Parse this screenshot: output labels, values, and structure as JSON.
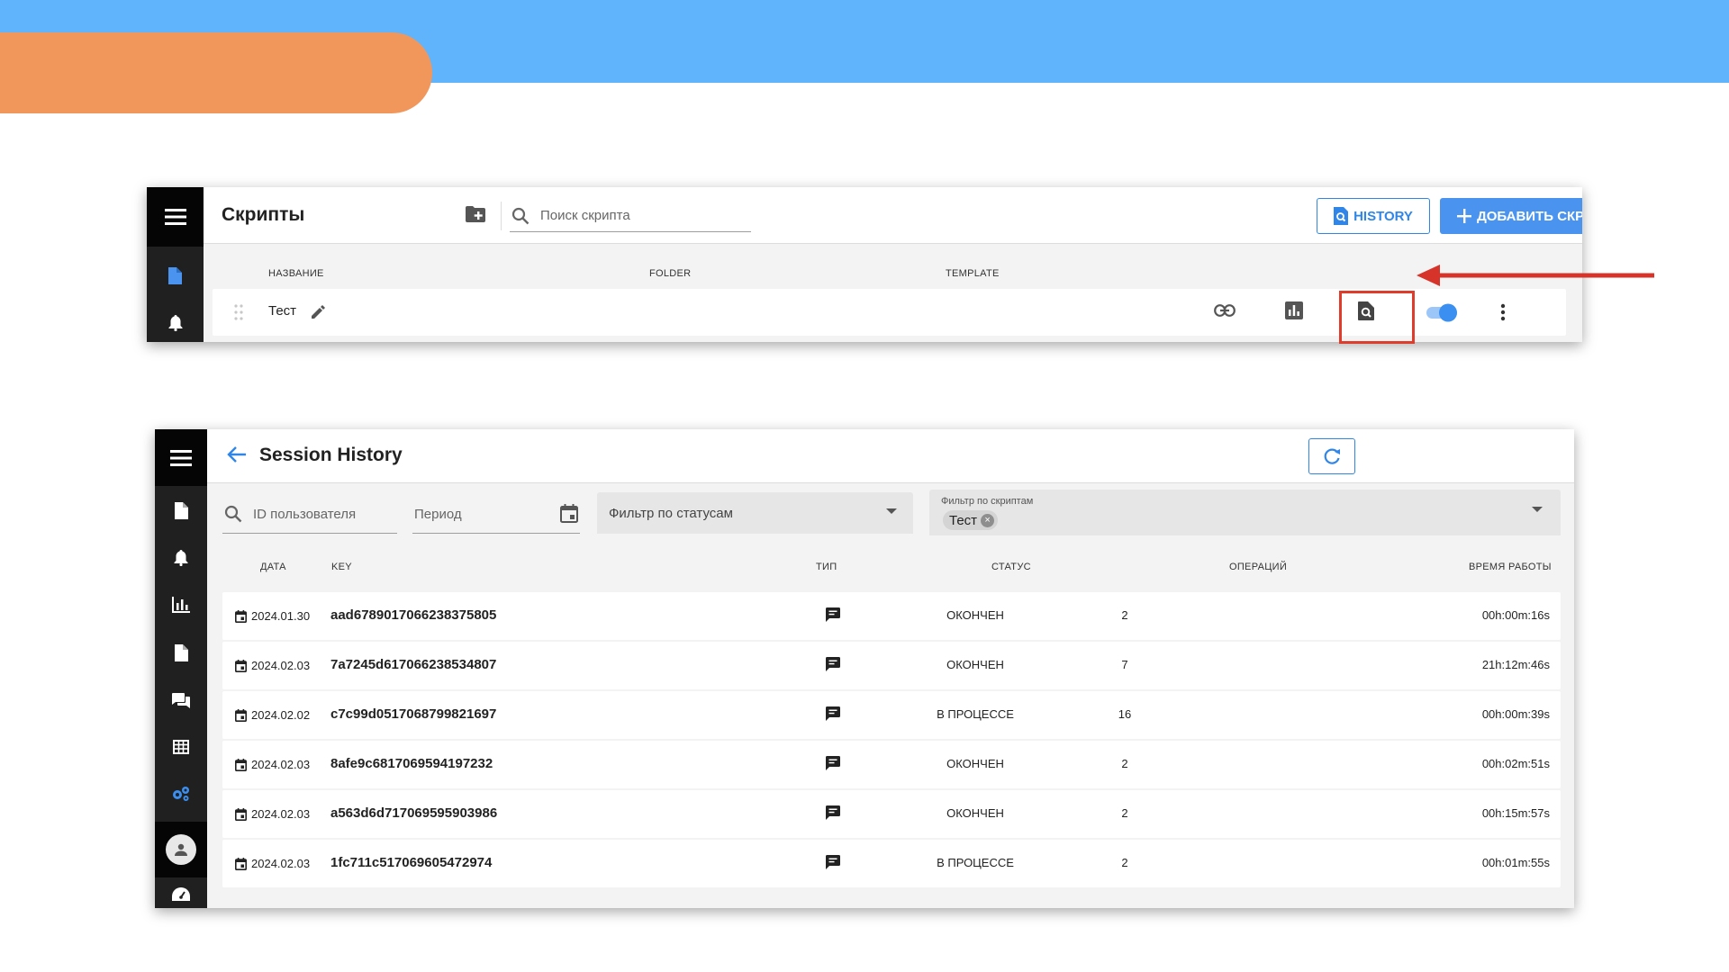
{
  "scripts_panel": {
    "title": "Скрипты",
    "search_placeholder": "Поиск скрипта",
    "history_button": "HISTORY",
    "add_button": "ДОБАВИТЬ СКРИПТ",
    "columns": [
      "НАЗВАНИЕ",
      "FOLDER",
      "TEMPLATE"
    ],
    "row": {
      "name": "Тест",
      "enabled": true
    }
  },
  "session_history": {
    "title": "Session History",
    "filters": {
      "user_id_placeholder": "ID пользователя",
      "period_placeholder": "Период",
      "status_placeholder": "Фильтр по статусам",
      "scripts_label": "Фильтр по скриптам",
      "scripts_chip": "Тест"
    },
    "columns": {
      "date": "ДАТА",
      "key": "KEY",
      "type": "ТИП",
      "status": "СТАТУС",
      "operations": "ОПЕРАЦИЙ",
      "runtime": "ВРЕМЯ РАБОТЫ"
    },
    "rows": [
      {
        "date": "2024.01.30",
        "key": "aad6789017066238375805",
        "status": "ОКОНЧЕН",
        "operations": "2",
        "runtime": "00h:00m:16s"
      },
      {
        "date": "2024.02.03",
        "key": "7a7245d617066238534807",
        "status": "ОКОНЧЕН",
        "operations": "7",
        "runtime": "21h:12m:46s"
      },
      {
        "date": "2024.02.02",
        "key": "c7c99d0517068799821697",
        "status": "В ПРОЦЕССЕ",
        "operations": "16",
        "runtime": "00h:00m:39s"
      },
      {
        "date": "2024.02.03",
        "key": "8afe9c6817069594197232",
        "status": "ОКОНЧЕН",
        "operations": "2",
        "runtime": "00h:02m:51s"
      },
      {
        "date": "2024.02.03",
        "key": "a563d6d717069595903986",
        "status": "ОКОНЧЕН",
        "operations": "2",
        "runtime": "00h:15m:57s"
      },
      {
        "date": "2024.02.03",
        "key": "1fc711c517069605472974",
        "status": "В ПРОЦЕССЕ",
        "operations": "2",
        "runtime": "00h:01m:55s"
      }
    ]
  },
  "colors": {
    "accent": "#2f86e8",
    "primary_button": "#4a94ef",
    "highlight": "#e03c2c",
    "top_band": "#5fb4fb",
    "orange_pill": "#f2975b",
    "sidebar": "#202020"
  },
  "icons": [
    "menu-icon",
    "document-icon",
    "bell-icon",
    "chart-icon",
    "chat-icon",
    "table-icon",
    "gears-icon",
    "user-icon",
    "dashboard-icon",
    "folder-add-icon",
    "search-icon",
    "history-search-icon",
    "plus-icon",
    "drag-handle-icon",
    "pencil-icon",
    "link-icon",
    "stats-icon",
    "toggle-switch",
    "more-vertical-icon",
    "back-arrow-icon",
    "refresh-icon",
    "calendar-icon",
    "dropdown-icon",
    "message-icon"
  ]
}
